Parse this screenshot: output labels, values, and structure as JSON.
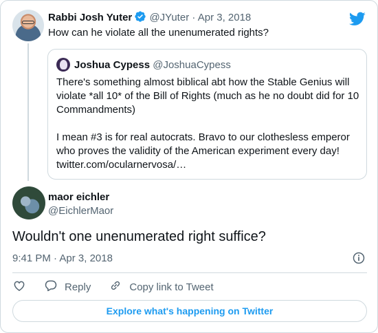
{
  "parent_tweet": {
    "author_name": "Rabbi Josh Yuter",
    "handle": "@JYuter",
    "separator": "·",
    "date": "Apr 3, 2018",
    "text": "How can he violate all the unenumerated rights?"
  },
  "quoted_tweet": {
    "author_name": "Joshua Cypess",
    "handle": "@JoshuaCypess",
    "paragraph_1": "There's something almost biblical abt how the Stable Genius will violate *all 10* of the Bill of Rights (much as he no doubt did for 10 Commandments)",
    "paragraph_2": "I mean #3 is for real autocrats. Bravo to our clothesless emperor who proves the validity of the American experiment every day! twitter.com/ocularnervosa/…"
  },
  "main_tweet": {
    "author_name": "maor eichler",
    "handle": "@EichlerMaor",
    "text": "Wouldn't one unenumerated right suffice?",
    "time": "9:41 PM",
    "separator": "·",
    "date": "Apr 3, 2018"
  },
  "actions": {
    "reply_label": "Reply",
    "copy_link_label": "Copy link to Tweet"
  },
  "explore_label": "Explore what's happening on Twitter",
  "colors": {
    "accent": "#1d9bf0",
    "muted": "#536471",
    "border": "#cfd9de"
  },
  "icons": [
    "verified-badge-icon",
    "twitter-bird-icon",
    "info-icon",
    "heart-icon",
    "reply-icon",
    "link-icon"
  ]
}
